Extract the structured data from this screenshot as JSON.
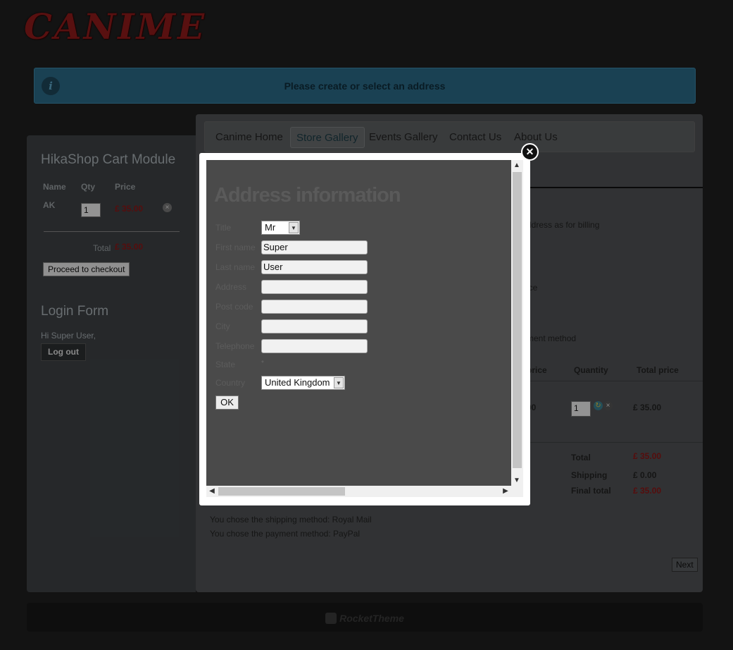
{
  "site": {
    "logo": "CANIME",
    "footer_brand": "RocketTheme"
  },
  "notice": {
    "message": "Please create or select an address",
    "icon": "info-icon"
  },
  "cart_module": {
    "title": "HikaShop Cart Module",
    "headers": {
      "name": "Name",
      "qty": "Qty",
      "price": "Price"
    },
    "item": {
      "name": "AK",
      "qty": "1",
      "price": "£ 35.00"
    },
    "total_label": "Total",
    "total_value": "£ 35.00",
    "checkout_label": "Proceed to checkout"
  },
  "login_module": {
    "title": "Login Form",
    "greeting": "Hi Super User,",
    "logout_label": "Log out"
  },
  "nav": {
    "items": [
      {
        "label": "Canime Home"
      },
      {
        "label": "Store Gallery",
        "active": true
      },
      {
        "label": "Events Gallery"
      },
      {
        "label": "Contact Us"
      },
      {
        "label": "About Us"
      }
    ]
  },
  "checkout": {
    "billing_text": "ddress as for billing",
    "price_text": "ice",
    "payment_text": "ment method",
    "table": {
      "headers": {
        "price": "price",
        "quantity": "Quantity",
        "total_price": "Total price"
      },
      "row": {
        "price_partial": "00",
        "qty": "1",
        "total": "£ 35.00"
      }
    },
    "summary": {
      "total_label": "Total",
      "total_value": "£ 35.00",
      "shipping_label": "Shipping",
      "shipping_value": "£ 0.00",
      "final_label": "Final total",
      "final_value": "£ 35.00"
    },
    "shipping_method_text": "You chose the shipping method: Royal Mail",
    "payment_method_text": "You chose the payment method: PayPal",
    "next_label": "Next"
  },
  "address_modal": {
    "title": "Address information",
    "labels": {
      "title": "Title",
      "first_name": "First name",
      "last_name": "Last name",
      "address": "Address",
      "post_code": "Post code",
      "city": "City",
      "telephone": "Telephone",
      "state": "State",
      "country": "Country"
    },
    "values": {
      "title": "Mr",
      "first_name": "Super",
      "last_name": "User",
      "address": "",
      "post_code": "",
      "city": "",
      "telephone": "",
      "country": "United Kingdom"
    },
    "required_mark": "*",
    "ok_label": "OK",
    "close_icon": "close-icon"
  }
}
